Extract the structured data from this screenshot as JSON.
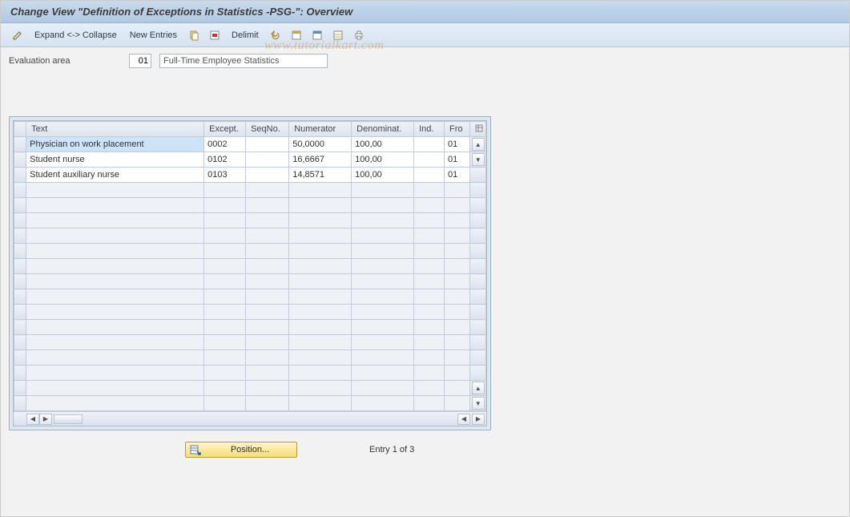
{
  "title": "Change View \"Definition of Exceptions in Statistics -PSG-\": Overview",
  "toolbar": {
    "expand_collapse": "Expand <-> Collapse",
    "new_entries": "New Entries",
    "delimit": "Delimit"
  },
  "fields": {
    "eval_area_label": "Evaluation area",
    "eval_area_code": "01",
    "eval_area_desc": "Full-Time Employee Statistics"
  },
  "columns": {
    "text": "Text",
    "except": "Except.",
    "seqno": "SeqNo.",
    "numerator": "Numerator",
    "denominat": "Denominat.",
    "ind": "Ind.",
    "fro": "Fro"
  },
  "rows": [
    {
      "text": "Physician on work placement",
      "except": "0002",
      "seqno": "",
      "numerator": "50,0000",
      "denominat": "100,00",
      "ind": "",
      "fro": "01",
      "selected": true
    },
    {
      "text": "Student nurse",
      "except": "0102",
      "seqno": "",
      "numerator": "16,6667",
      "denominat": "100,00",
      "ind": "",
      "fro": "01"
    },
    {
      "text": "Student auxiliary nurse",
      "except": "0103",
      "seqno": "",
      "numerator": "14,8571",
      "denominat": "100,00",
      "ind": "",
      "fro": "01"
    }
  ],
  "footer": {
    "position_label": "Position...",
    "entry_status": "Entry 1 of 3"
  },
  "watermark": "www.tutorialkart.com"
}
